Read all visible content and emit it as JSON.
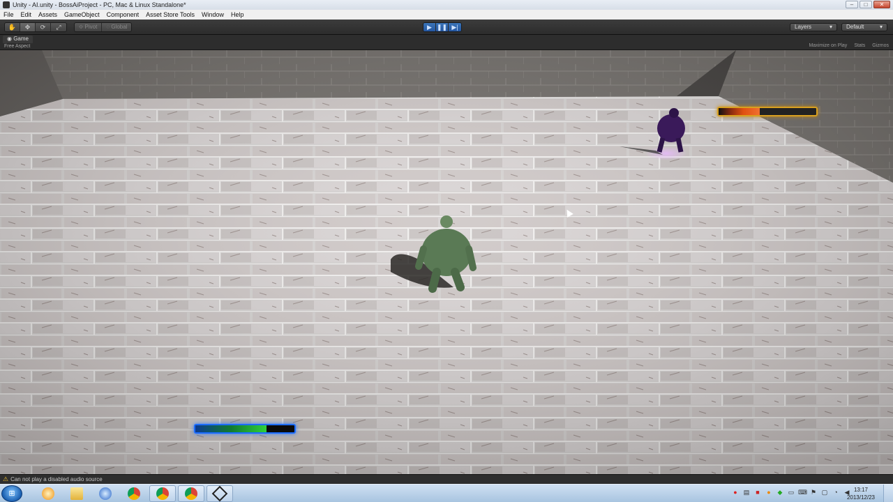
{
  "window": {
    "title": "Unity - AI.unity - BossAiProject - PC, Mac & Linux Standalone*",
    "minimize": "–",
    "maximize": "□",
    "close": "✕"
  },
  "menu": [
    "File",
    "Edit",
    "Assets",
    "GameObject",
    "Component",
    "Asset Store Tools",
    "Window",
    "Help"
  ],
  "toolbar": {
    "pivot_label": "Pivot",
    "global_label": "Global",
    "layers_label": "Layers",
    "layout_label": "Default",
    "play_state": "playing"
  },
  "game_panel": {
    "tab_label": "Game",
    "aspect_label": "Free Aspect",
    "maximize_label": "Maximize on Play",
    "stats_label": "Stats",
    "gizmos_label": "Gizmos"
  },
  "game": {
    "enemy_health_fraction": 0.42,
    "player_health_fraction": 0.72,
    "colors": {
      "enemy_bar_border": "#d8a020",
      "player_bar_border": "#1c6cff",
      "player_character": "#5a7a55",
      "enemy_character": "#3a1a5a"
    }
  },
  "status": {
    "message": "Can not play a disabled audio source"
  },
  "taskbar": {
    "icons": [
      "media-player-icon",
      "folder-icon",
      "itunes-icon",
      "chrome-icon",
      "chrome-icon",
      "chrome-icon",
      "unity-icon"
    ],
    "time": "13:17",
    "date": "2013/12/23"
  }
}
